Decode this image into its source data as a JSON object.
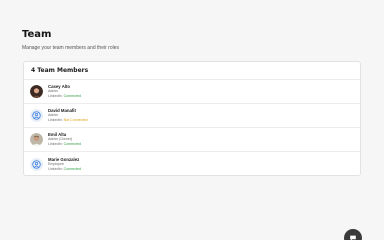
{
  "page": {
    "title": "Team",
    "subtitle": "Manage your team members and their roles"
  },
  "team_card": {
    "header": "4 Team Members",
    "linkedin_label": "LinkedIn:",
    "members": [
      {
        "name": "Casey Alto",
        "role": "Admin",
        "linkedin_status": "Connected",
        "avatar": "photo"
      },
      {
        "name": "David Manafit",
        "role": "Admin",
        "linkedin_status": "Not Connected",
        "avatar": "default-user-icon"
      },
      {
        "name": "Emil Alta",
        "role": "Admin (Owner)",
        "linkedin_status": "Connected",
        "avatar": "photo"
      },
      {
        "name": "Marie Gonzalez",
        "role": "Employee",
        "linkedin_status": "Connected",
        "avatar": "default-user-icon"
      }
    ]
  },
  "colors": {
    "connected": "#2f9e44",
    "not_connected": "#e0a012",
    "default_avatar_icon": "#3b7ddd"
  },
  "chat": {
    "icon": "chat-bubble-icon"
  }
}
